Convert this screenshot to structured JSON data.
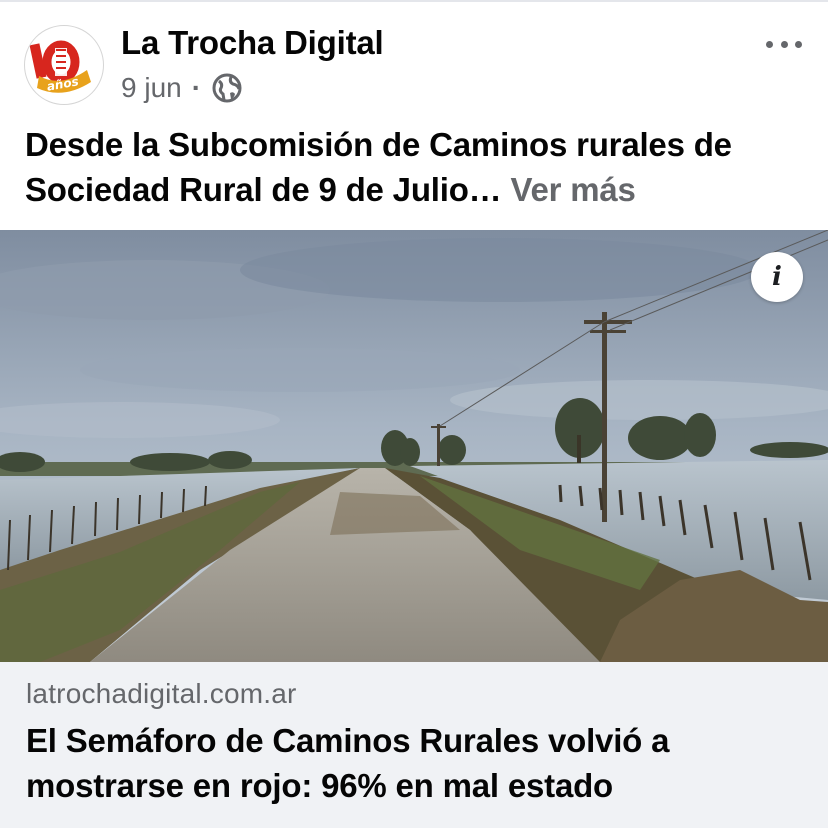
{
  "post": {
    "page_name": "La Trocha Digital",
    "date": "9 jun",
    "separator": "·",
    "privacy_icon": "globe-icon",
    "caption_text": "Desde la Subcomisión de Caminos rurales de Sociedad Rural de 9 de Julio…",
    "see_more": "Ver más",
    "more_icon": "more-horizontal-icon",
    "avatar": {
      "badge_number": "10",
      "badge_word": "años"
    }
  },
  "media": {
    "info_label": "i"
  },
  "link_preview": {
    "domain": "latrochadigital.com.ar",
    "headline": "El Semáforo de Caminos Rurales volvió a mostrarse en rojo: 96% en mal estado"
  },
  "colors": {
    "text_primary": "#050505",
    "text_secondary": "#65676b",
    "card_background": "#f0f2f5",
    "avatar_red": "#d7261e",
    "avatar_gold": "#e8a21c"
  }
}
